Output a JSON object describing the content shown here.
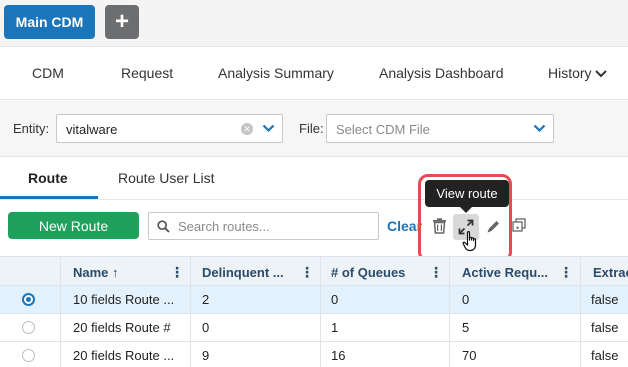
{
  "top": {
    "main_cdm": "Main CDM",
    "plus": "+"
  },
  "nav": {
    "items": [
      "CDM",
      "Request",
      "Analysis Summary",
      "Analysis Dashboard",
      "History"
    ]
  },
  "filters": {
    "entity_label": "Entity:",
    "entity_value": "vitalware",
    "file_label": "File:",
    "file_placeholder": "Select CDM File"
  },
  "tabs": {
    "items": [
      "Route",
      "Route User List"
    ],
    "active": "Route"
  },
  "toolbar": {
    "new_route": "New Route",
    "search_placeholder": "Search routes...",
    "clear": "Clear",
    "tooltip": "View route"
  },
  "table": {
    "columns": [
      "Name ↑",
      "Delinquent ...",
      "# of Queues",
      "Active Requ...",
      "Extrac"
    ],
    "rows": [
      {
        "name": "10 fields Route ...",
        "delinquent": "2",
        "queues": "0",
        "active": "0",
        "extract": "false",
        "selected": true
      },
      {
        "name": "20 fields Route #",
        "delinquent": "0",
        "queues": "1",
        "active": "5",
        "extract": "false",
        "selected": false
      },
      {
        "name": "20 fields Route ...",
        "delinquent": "9",
        "queues": "16",
        "active": "70",
        "extract": "false",
        "selected": false
      }
    ]
  },
  "colors": {
    "primary": "#1b75bb",
    "success": "#1fa15b",
    "highlight": "#e34b55"
  }
}
